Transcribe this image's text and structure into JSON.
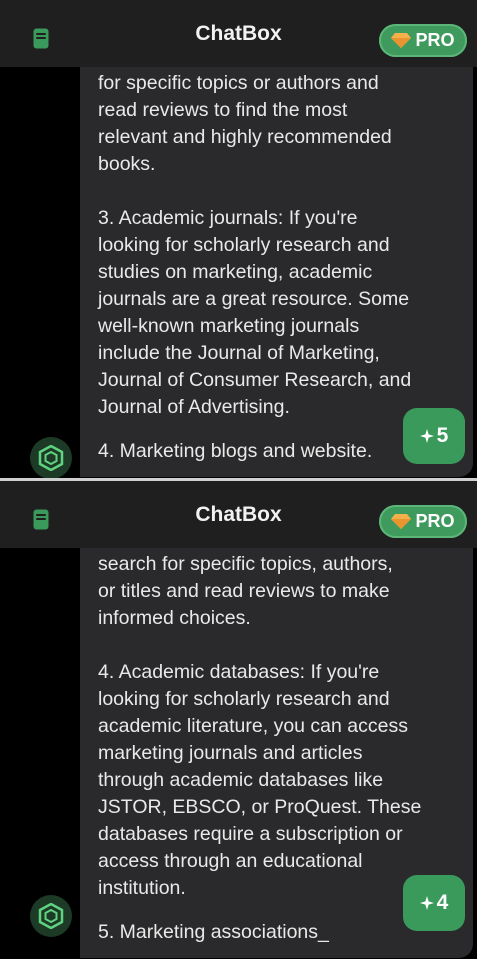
{
  "colors": {
    "accent": "#3a9a5b",
    "header_bg": "#1f1f1f",
    "message_bg": "#2a2a2c",
    "text": "#e9e9e9"
  },
  "panels": [
    {
      "header": {
        "title": "ChatBox",
        "pro_label": "PRO"
      },
      "message": {
        "text": "for specific topics or authors and\nread reviews to find the most\nrelevant and highly recommended\nbooks.\n\n3. Academic journals: If you're\nlooking for scholarly research and\nstudies on marketing, academic\njournals are a great resource. Some\nwell-known marketing journals\ninclude the Journal of Marketing,\nJournal of Consumer Research, and\nJournal of Advertising.",
        "last_line": "4. Marketing blogs and website."
      },
      "credits": {
        "count": "5"
      }
    },
    {
      "header": {
        "title": "ChatBox",
        "pro_label": "PRO"
      },
      "message": {
        "text": "search for specific topics, authors,\nor titles and read reviews to make\ninformed choices.\n\n4. Academic databases: If you're\nlooking for scholarly research and\nacademic literature, you can access\nmarketing journals and articles\nthrough academic databases like\nJSTOR, EBSCO, or ProQuest. These\ndatabases require a subscription or\naccess through an educational\ninstitution.",
        "last_line": "5. Marketing associations_"
      },
      "credits": {
        "count": "4"
      }
    }
  ],
  "icons": {
    "sidebar": "sidebar-icon",
    "pro": "gem-icon",
    "avatar": "hexagon-logo-icon",
    "credits": "sparkle-icon"
  }
}
